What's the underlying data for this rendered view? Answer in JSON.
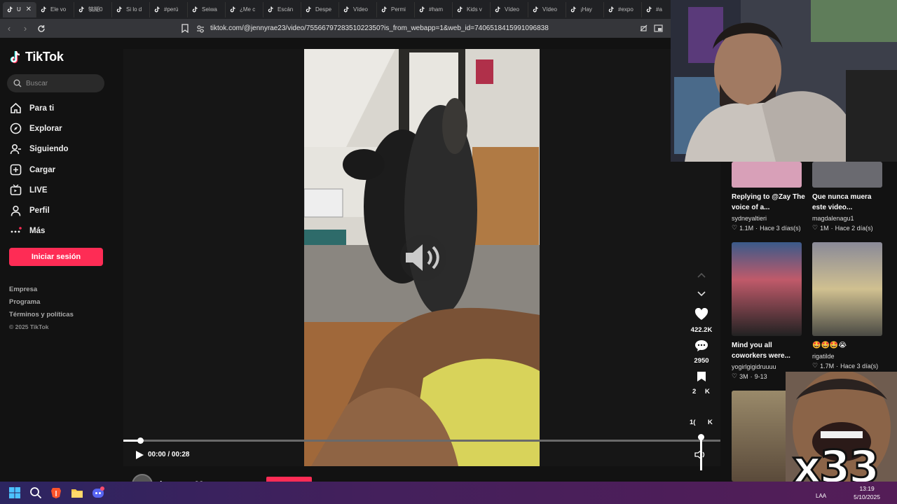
{
  "browser": {
    "tabs": [
      {
        "label": "U",
        "active": true
      },
      {
        "label": "Ele vo"
      },
      {
        "label": "犒糊0"
      },
      {
        "label": "Si lo d"
      },
      {
        "label": "#perú"
      },
      {
        "label": "Seiwa"
      },
      {
        "label": "¿Me c"
      },
      {
        "label": "Escán"
      },
      {
        "label": "Despe"
      },
      {
        "label": "Vídeo"
      },
      {
        "label": "Permi"
      },
      {
        "label": "#ham"
      },
      {
        "label": "Kids v"
      },
      {
        "label": "Vídeo"
      },
      {
        "label": "Vídeo"
      },
      {
        "label": "¡Hay"
      },
      {
        "label": "#expo"
      },
      {
        "label": "#a"
      }
    ],
    "url": "tiktok.com/@jennyrae23/video/7556679728351022350?is_from_webapp=1&web_id=7406518415991096838"
  },
  "sidebar": {
    "logo": "TikTok",
    "search_placeholder": "Buscar",
    "nav": [
      {
        "label": "Para ti",
        "icon": "home-icon"
      },
      {
        "label": "Explorar",
        "icon": "compass-icon"
      },
      {
        "label": "Siguiendo",
        "icon": "following-icon"
      },
      {
        "label": "Cargar",
        "icon": "upload-icon"
      },
      {
        "label": "LIVE",
        "icon": "live-icon"
      },
      {
        "label": "Perfil",
        "icon": "profile-icon"
      },
      {
        "label": "Más",
        "icon": "more-icon"
      }
    ],
    "login_label": "Iniciar sesión",
    "footer": [
      "Empresa",
      "Programa",
      "Términos y políticas"
    ],
    "copyright": "© 2025 TikTok"
  },
  "player": {
    "time": "00:00 / 00:28",
    "progress_fraction": 0.028,
    "likes": "422.2K",
    "comments": "2950",
    "saves_partial": "2",
    "saves_partial_end": "K",
    "shares_partial": "1(",
    "shares_partial_end": "K",
    "username": "jennyrae23"
  },
  "cards": [
    {
      "title": "Replying to @Zay The voice of a...",
      "user": "sydneyaltieri",
      "likes": "1.1M",
      "date": "Hace 3 días(s)"
    },
    {
      "title": "Que nunca muera este video...",
      "user": "magdalenagu1",
      "likes": "1M",
      "date": "Hace 2 día(s)"
    },
    {
      "title": "Mind you all coworkers were...",
      "user": "yogirlgigidruuuu",
      "likes": "3M",
      "date": "9-13"
    },
    {
      "title": "🤩🤩🤩😭",
      "user": "rigatilde",
      "likes": "1.7M",
      "date": "Hace 3 día(s)"
    }
  ],
  "meme_text": "x33",
  "taskbar": {
    "time": "13:19",
    "date": "5/10/2025",
    "lang": "LAA"
  },
  "colors": {
    "accent": "#fe2c55",
    "background": "#121212"
  }
}
